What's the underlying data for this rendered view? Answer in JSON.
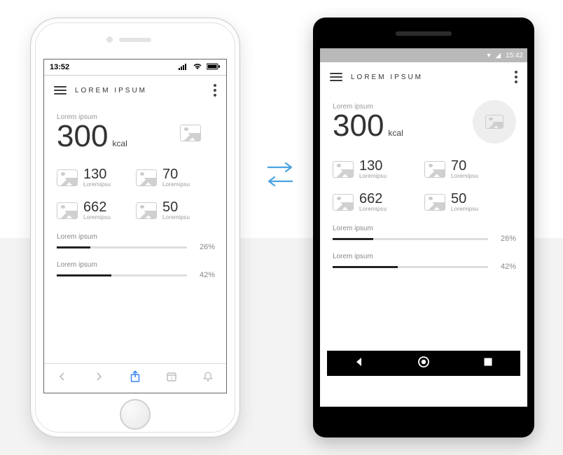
{
  "ios": {
    "status": {
      "time": "13:52"
    },
    "header": {
      "title": "LOREM IPSUM"
    },
    "summary": {
      "label": "Lorem ipsum",
      "value": "300",
      "unit": "kcal"
    },
    "stats": [
      {
        "value": "130",
        "label": "Loremipsu"
      },
      {
        "value": "70",
        "label": "Loremipsu"
      },
      {
        "value": "662",
        "label": "Loremipsu"
      },
      {
        "value": "50",
        "label": "Loremipsu"
      }
    ],
    "progress": [
      {
        "label": "Lorem ipsum",
        "pct": 26,
        "pct_text": "26%"
      },
      {
        "label": "Lorem ipsum",
        "pct": 42,
        "pct_text": "42%"
      }
    ]
  },
  "android": {
    "status": {
      "time": "15:42"
    },
    "header": {
      "title": "LOREM IPSUM"
    },
    "summary": {
      "label": "Lorem ipsum",
      "value": "300",
      "unit": "kcal"
    },
    "stats": [
      {
        "value": "130",
        "label": "Loremipsu"
      },
      {
        "value": "70",
        "label": "Loremipsu"
      },
      {
        "value": "662",
        "label": "Loremipsu"
      },
      {
        "value": "50",
        "label": "Loremipsu"
      }
    ],
    "progress": [
      {
        "label": "Lorem ipsum",
        "pct": 26,
        "pct_text": "26%"
      },
      {
        "label": "Lorem ipsum",
        "pct": 42,
        "pct_text": "42%"
      }
    ]
  }
}
